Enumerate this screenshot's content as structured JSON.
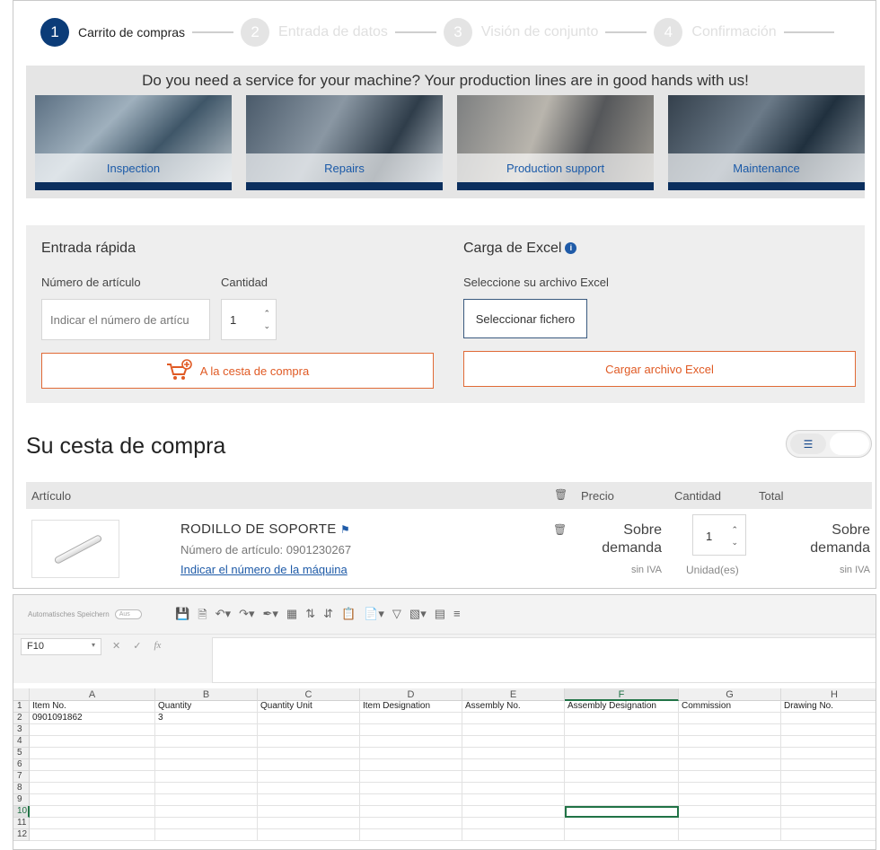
{
  "steps": [
    {
      "number": "1",
      "label": "Carrito de compras"
    },
    {
      "number": "2",
      "label": "Entrada de datos"
    },
    {
      "number": "3",
      "label": "Visión de conjunto"
    },
    {
      "number": "4",
      "label": "Confirmación"
    }
  ],
  "promo": {
    "headline": "Do you need a service for your machine? Your production lines are in good hands with us!",
    "tiles": [
      "Inspection",
      "Repairs",
      "Production support",
      "Maintenance"
    ]
  },
  "quick_entry": {
    "title": "Entrada rápida",
    "article_label": "Número de artículo",
    "article_placeholder": "Indicar el número de artícu",
    "quantity_label": "Cantidad",
    "quantity_value": "1",
    "add_button": "A la cesta de compra"
  },
  "excel_upload": {
    "title": "Carga de Excel",
    "file_label": "Seleccione su archivo Excel",
    "select_button": "Seleccionar fichero",
    "upload_button": "Cargar archivo Excel"
  },
  "cart": {
    "title": "Su cesta de compra",
    "columns": {
      "article": "Artículo",
      "price": "Precio",
      "quantity": "Cantidad",
      "total": "Total"
    },
    "item": {
      "name": "RODILLO DE SOPORTE",
      "article_number": "Número de artículo: 0901230267",
      "machine_link": "Indicar el número de la máquina",
      "price_line1": "Sobre",
      "price_line2": "demanda",
      "price_vat": "sin IVA",
      "quantity": "1",
      "unit": "Unidad(es)",
      "total_line1": "Sobre",
      "total_line2": "demanda",
      "total_vat": "sin IVA"
    }
  },
  "spreadsheet": {
    "autosave_label": "Automatisches Speichern",
    "autosave_state": "Aus",
    "name_box": "F10",
    "fx_label": "fx",
    "columns": [
      "A",
      "B",
      "C",
      "D",
      "E",
      "F",
      "G",
      "H"
    ],
    "selected_column": "F",
    "selected_row": "10",
    "rows": [
      {
        "num": "1",
        "cells": [
          "Item No.",
          "Quantity",
          "Quantity Unit",
          "Item Designation",
          "Assembly No.",
          "Assembly Designation",
          "Commission",
          "Drawing No."
        ]
      },
      {
        "num": "2",
        "cells": [
          "0901091862",
          "3",
          "",
          "",
          "",
          "",
          "",
          ""
        ]
      },
      {
        "num": "3",
        "cells": [
          "",
          "",
          "",
          "",
          "",
          "",
          "",
          ""
        ]
      },
      {
        "num": "4",
        "cells": [
          "",
          "",
          "",
          "",
          "",
          "",
          "",
          ""
        ]
      },
      {
        "num": "5",
        "cells": [
          "",
          "",
          "",
          "",
          "",
          "",
          "",
          ""
        ]
      },
      {
        "num": "6",
        "cells": [
          "",
          "",
          "",
          "",
          "",
          "",
          "",
          ""
        ]
      },
      {
        "num": "7",
        "cells": [
          "",
          "",
          "",
          "",
          "",
          "",
          "",
          ""
        ]
      },
      {
        "num": "8",
        "cells": [
          "",
          "",
          "",
          "",
          "",
          "",
          "",
          ""
        ]
      },
      {
        "num": "9",
        "cells": [
          "",
          "",
          "",
          "",
          "",
          "",
          "",
          ""
        ]
      },
      {
        "num": "10",
        "cells": [
          "",
          "",
          "",
          "",
          "",
          "",
          "",
          ""
        ]
      },
      {
        "num": "11",
        "cells": [
          "",
          "",
          "",
          "",
          "",
          "",
          "",
          ""
        ]
      },
      {
        "num": "12",
        "cells": [
          "",
          "",
          "",
          "",
          "",
          "",
          "",
          ""
        ]
      }
    ]
  }
}
